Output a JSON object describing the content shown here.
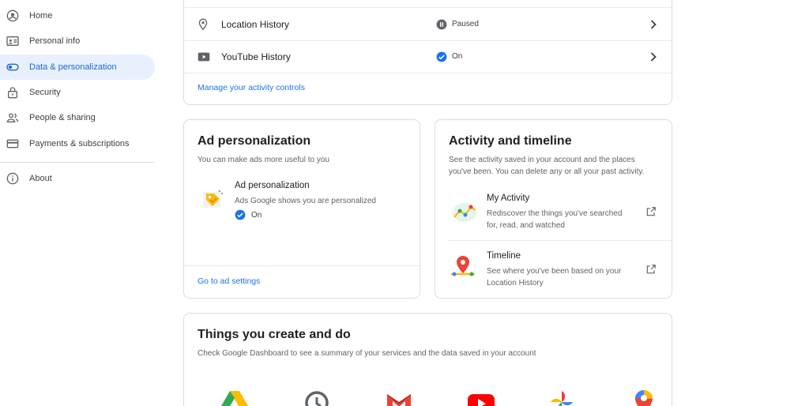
{
  "sidebar": {
    "items": [
      {
        "label": "Home",
        "icon": "account-circle-icon"
      },
      {
        "label": "Personal info",
        "icon": "id-card-icon"
      },
      {
        "label": "Data & personalization",
        "icon": "toggle-icon"
      },
      {
        "label": "Security",
        "icon": "lock-icon"
      },
      {
        "label": "People & sharing",
        "icon": "people-icon"
      },
      {
        "label": "Payments & subscriptions",
        "icon": "credit-card-icon"
      },
      {
        "label": "About",
        "icon": "info-icon"
      }
    ],
    "active_index": 2
  },
  "activity_controls": {
    "rows": [
      {
        "label": "Location History",
        "status": "Paused",
        "status_icon": "pause-icon"
      },
      {
        "label": "YouTube History",
        "status": "On",
        "status_icon": "check-circle-icon"
      }
    ],
    "manage_link": "Manage your activity controls"
  },
  "ad_personalization": {
    "title": "Ad personalization",
    "description": "You can make ads more useful to you",
    "item_title": "Ad personalization",
    "item_subtitle": "Ads Google shows you are personalized",
    "item_status": "On",
    "link": "Go to ad settings"
  },
  "activity_timeline": {
    "title": "Activity and timeline",
    "description_line1": "See the activity saved in your account and the places",
    "description_line2": "you've been. You can delete any or all your past activity.",
    "items": [
      {
        "title": "My Activity",
        "sub1": "Rediscover the things you've searched",
        "sub2": "for, read, and watched",
        "icon": "my-activity-icon"
      },
      {
        "title": "Timeline",
        "sub1": "See where you've been based on your",
        "sub2": "Location History",
        "icon": "timeline-pin-icon"
      }
    ]
  },
  "things": {
    "title": "Things you create and do",
    "description": "Check Google Dashboard to see a summary of your services and the data saved in your account",
    "icons": [
      "drive-icon",
      "history-icon",
      "gmail-icon",
      "youtube-icon",
      "photos-icon",
      "maps-icon"
    ]
  },
  "colors": {
    "accent": "#1a73e8",
    "active_bg": "#e8f0fe",
    "border": "#dadce0"
  }
}
